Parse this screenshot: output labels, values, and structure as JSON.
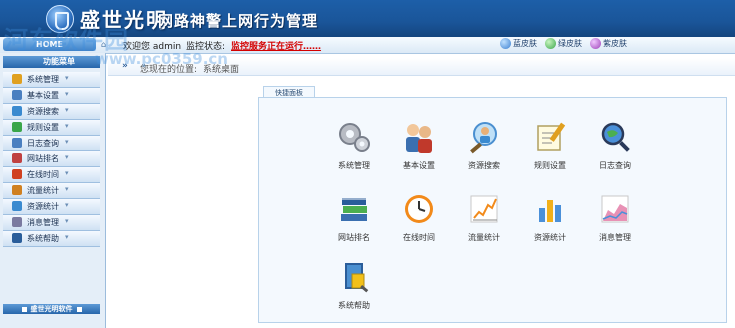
{
  "header": {
    "brand": "盛世光明",
    "title": "网路神警上网行为管理"
  },
  "watermark": {
    "line1": "河东软件园",
    "line2": "www.pc0359.cn"
  },
  "statusbar": {
    "home_label": "HOME",
    "welcome": "欢迎您 admin",
    "monitor_label": "监控状态:",
    "monitor_value": "监控服务正在运行……",
    "skins": [
      {
        "label": "蓝皮肤",
        "color": "#3b7fd0"
      },
      {
        "label": "绿皮肤",
        "color": "#3aa64a"
      },
      {
        "label": "紫皮肤",
        "color": "#9c3fb8"
      }
    ]
  },
  "breadcrumb": {
    "prefix": "您现在的位置:",
    "current": "系统桌面"
  },
  "sidebar": {
    "title": "功能菜单",
    "footer": "盛世光明软件",
    "items": [
      {
        "label": "系统管理",
        "icon": "gear-icon",
        "color": "#e0a020"
      },
      {
        "label": "基本设置",
        "icon": "users-icon",
        "color": "#4a7fc0"
      },
      {
        "label": "资源搜索",
        "icon": "search-icon",
        "color": "#3a8ad0"
      },
      {
        "label": "规则设置",
        "icon": "rules-icon",
        "color": "#3aa64a"
      },
      {
        "label": "日志查询",
        "icon": "log-icon",
        "color": "#4a7fc0"
      },
      {
        "label": "网站排名",
        "icon": "rank-icon",
        "color": "#c04040"
      },
      {
        "label": "在线时间",
        "icon": "clock-icon",
        "color": "#d04020"
      },
      {
        "label": "流量统计",
        "icon": "traffic-icon",
        "color": "#d08020"
      },
      {
        "label": "资源统计",
        "icon": "stats-icon",
        "color": "#3a8ad0"
      },
      {
        "label": "消息管理",
        "icon": "message-icon",
        "color": "#7a7aa0"
      },
      {
        "label": "系统帮助",
        "icon": "help-icon",
        "color": "#2a5d9a"
      }
    ]
  },
  "quick_panel": {
    "tab_label": "快捷面板",
    "tiles": [
      {
        "label": "系统管理",
        "icon": "gears-icon"
      },
      {
        "label": "基本设置",
        "icon": "users-icon"
      },
      {
        "label": "资源搜索",
        "icon": "search-user-icon"
      },
      {
        "label": "规则设置",
        "icon": "edit-doc-icon"
      },
      {
        "label": "日志查询",
        "icon": "magnifier-globe-icon"
      },
      {
        "label": "网站排名",
        "icon": "books-icon"
      },
      {
        "label": "在线时间",
        "icon": "clock-icon"
      },
      {
        "label": "流量统计",
        "icon": "line-chart-icon"
      },
      {
        "label": "资源统计",
        "icon": "bar-chart-icon"
      },
      {
        "label": "消息管理",
        "icon": "area-chart-icon"
      },
      {
        "label": "系统帮助",
        "icon": "help-book-icon"
      }
    ]
  }
}
